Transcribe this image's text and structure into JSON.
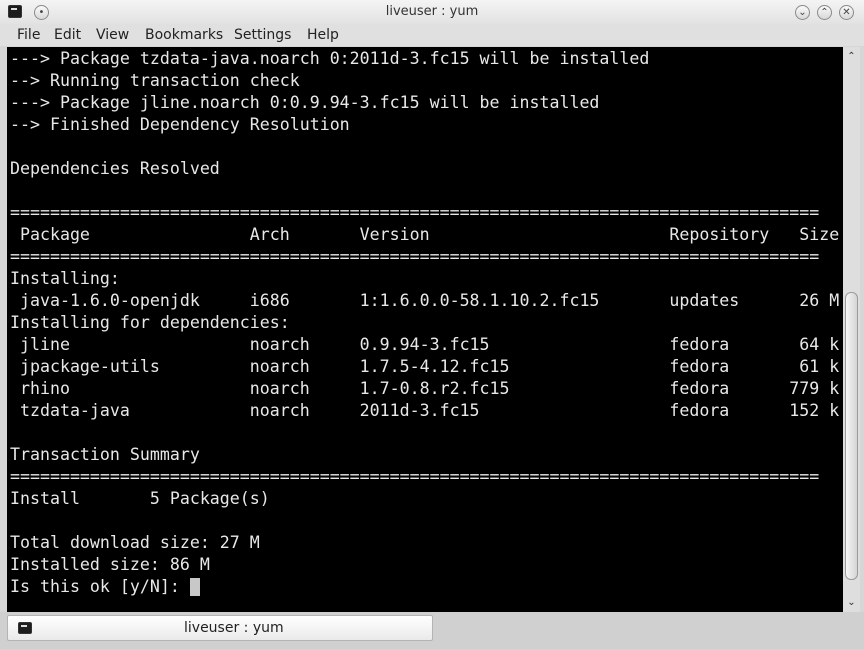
{
  "window": {
    "title": "liveuser : yum",
    "buttons": {
      "pin": "•",
      "minimize": "⌄",
      "maximize": "⌃",
      "close": "✕"
    }
  },
  "menu": [
    "File",
    "Edit",
    "View",
    "Bookmarks",
    "Settings",
    "Help"
  ],
  "terminal": {
    "lines": [
      "---> Package tzdata-java.noarch 0:2011d-3.fc15 will be installed",
      "--> Running transaction check",
      "---> Package jline.noarch 0:0.9.94-3.fc15 will be installed",
      "--> Finished Dependency Resolution",
      "",
      "Dependencies Resolved",
      "",
      "=================================================================================",
      " Package                Arch       Version                        Repository   Size",
      "=================================================================================",
      "Installing:",
      " java-1.6.0-openjdk     i686       1:1.6.0.0-58.1.10.2.fc15       updates      26 M",
      "Installing for dependencies:",
      " jline                  noarch     0.9.94-3.fc15                  fedora       64 k",
      " jpackage-utils         noarch     1.7.5-4.12.fc15                fedora       61 k",
      " rhino                  noarch     1.7-0.8.r2.fc15                fedora      779 k",
      " tzdata-java            noarch     2011d-3.fc15                   fedora      152 k",
      "",
      "Transaction Summary",
      "=================================================================================",
      "Install       5 Package(s)",
      "",
      "Total download size: 27 M",
      "Installed size: 86 M",
      "Is this ok [y/N]: "
    ]
  },
  "scrollbar": {
    "up": "⌃",
    "down": "⌄"
  },
  "tabs": [
    {
      "label": "liveuser : yum"
    }
  ]
}
